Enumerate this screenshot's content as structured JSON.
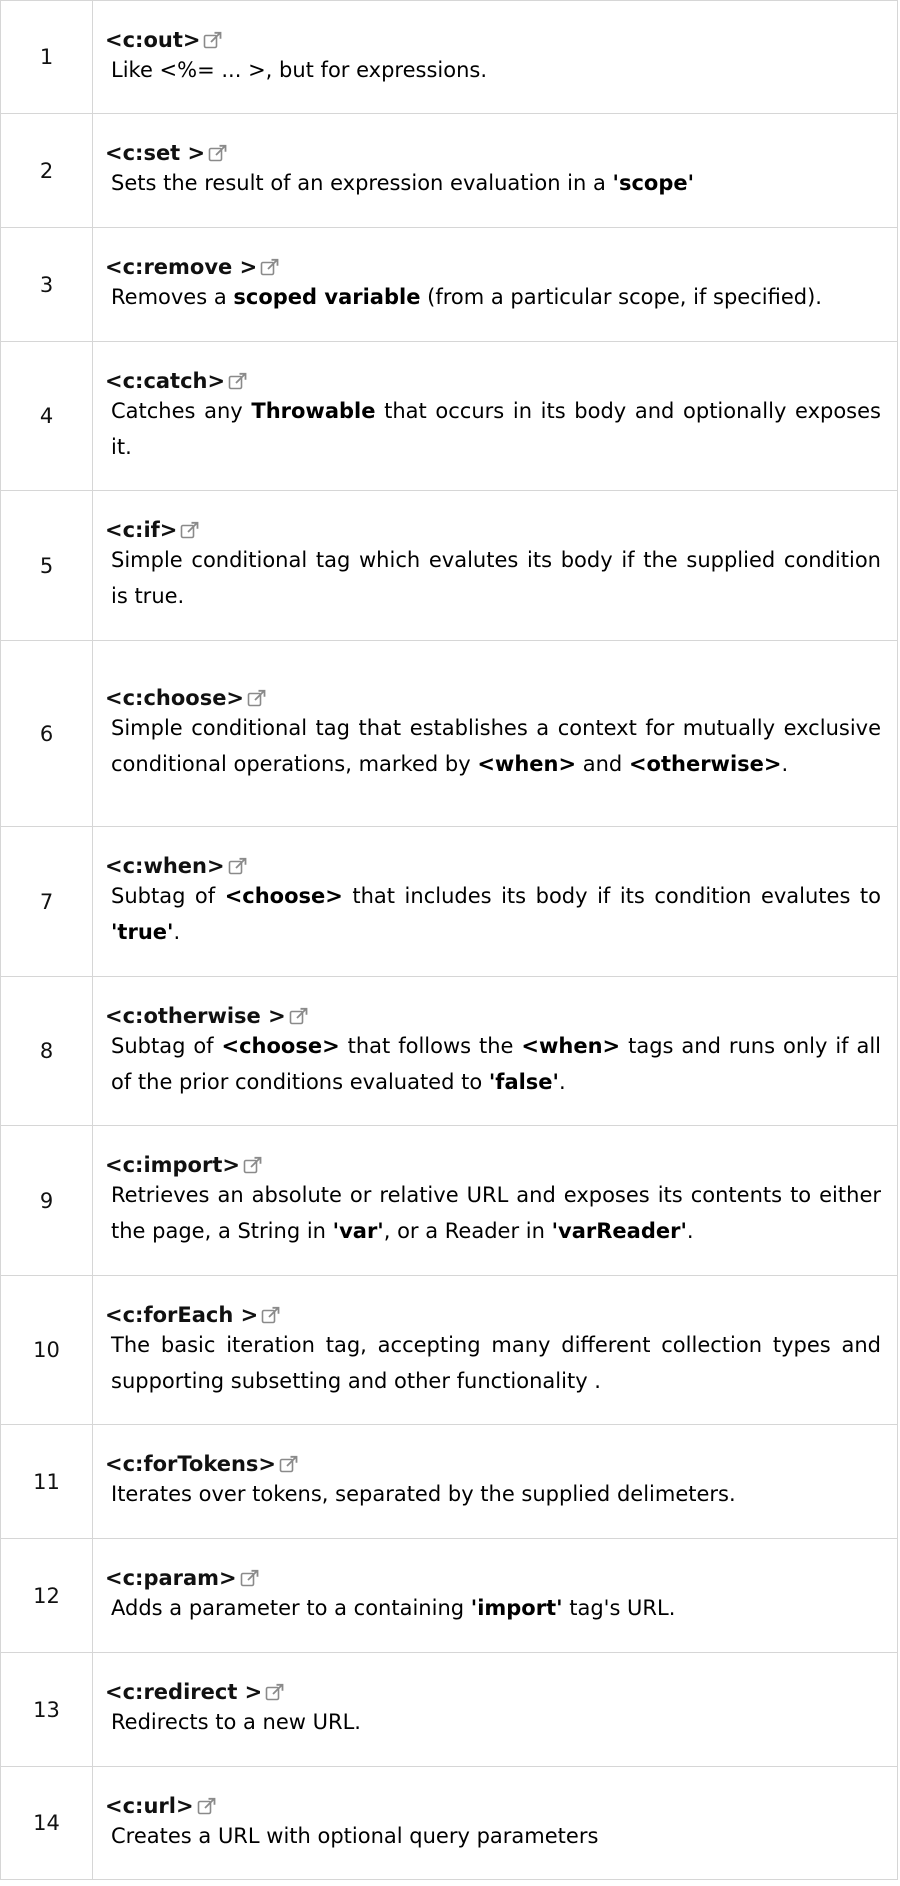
{
  "rows": [
    {
      "num": "1",
      "tag": "<c:out>",
      "segments": [
        {
          "t": "Like <%= ... >, but for expressions."
        }
      ]
    },
    {
      "num": "2",
      "tag": "<c:set >",
      "segments": [
        {
          "t": "Sets the result of an expression evaluation in a "
        },
        {
          "t": "'scope'",
          "b": true
        }
      ]
    },
    {
      "num": "3",
      "tag": "<c:remove >",
      "segments": [
        {
          "t": "Removes a "
        },
        {
          "t": "scoped variable",
          "b": true
        },
        {
          "t": " (from a particular scope, if specified)."
        }
      ]
    },
    {
      "num": "4",
      "tag": "<c:catch>",
      "segments": [
        {
          "t": "Catches any "
        },
        {
          "t": "Throwable",
          "b": true
        },
        {
          "t": " that occurs in its body and optionally exposes it."
        }
      ]
    },
    {
      "num": "5",
      "tag": "<c:if>",
      "segments": [
        {
          "t": "Simple conditional tag which evalutes its body if the supplied condition is true."
        }
      ]
    },
    {
      "num": "6",
      "tag": "<c:choose>",
      "segments": [
        {
          "t": "Simple conditional tag that establishes a context for mutually exclusive conditional operations, marked by "
        },
        {
          "t": "<when>",
          "b": true
        },
        {
          "t": " and "
        },
        {
          "t": "<otherwise>",
          "b": true
        },
        {
          "t": "."
        }
      ]
    },
    {
      "num": "7",
      "tag": "<c:when>",
      "segments": [
        {
          "t": "Subtag of "
        },
        {
          "t": "<choose>",
          "b": true
        },
        {
          "t": " that includes its body if its condition evalutes to "
        },
        {
          "t": "'true'",
          "b": true
        },
        {
          "t": "."
        }
      ]
    },
    {
      "num": "8",
      "tag": "<c:otherwise >",
      "segments": [
        {
          "t": "Subtag of "
        },
        {
          "t": "<choose>",
          "b": true
        },
        {
          "t": " that follows the "
        },
        {
          "t": "<when>",
          "b": true
        },
        {
          "t": " tags and runs only if all of the prior conditions evaluated to "
        },
        {
          "t": "'false'",
          "b": true
        },
        {
          "t": "."
        }
      ]
    },
    {
      "num": "9",
      "tag": "<c:import>",
      "segments": [
        {
          "t": "Retrieves an absolute or relative URL and exposes its contents to either the page, a String in "
        },
        {
          "t": "'var'",
          "b": true
        },
        {
          "t": ", or a Reader in "
        },
        {
          "t": "'varReader'",
          "b": true
        },
        {
          "t": "."
        }
      ]
    },
    {
      "num": "10",
      "tag": "<c:forEach >",
      "segments": [
        {
          "t": "The basic iteration tag, accepting many different collection types and supporting subsetting and other functionality ."
        }
      ]
    },
    {
      "num": "11",
      "tag": "<c:forTokens>",
      "segments": [
        {
          "t": "Iterates over tokens, separated by the supplied delimeters."
        }
      ]
    },
    {
      "num": "12",
      "tag": "<c:param>",
      "segments": [
        {
          "t": "Adds a parameter to a containing "
        },
        {
          "t": "'import'",
          "b": true
        },
        {
          "t": " tag's URL."
        }
      ]
    },
    {
      "num": "13",
      "tag": "<c:redirect >",
      "segments": [
        {
          "t": "Redirects to a new URL."
        }
      ]
    },
    {
      "num": "14",
      "tag": "<c:url>",
      "segments": [
        {
          "t": "Creates a URL with optional query parameters"
        }
      ]
    }
  ],
  "icons": {
    "tag_link": "external-link-icon"
  },
  "colors": {
    "border": "#d6d6d6",
    "text": "#000000",
    "icon": "#8a8a8a"
  }
}
